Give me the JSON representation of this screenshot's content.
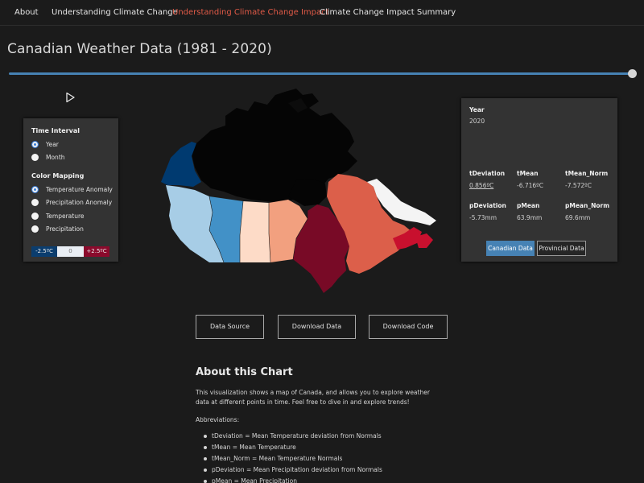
{
  "nav": {
    "items": [
      {
        "label": "About"
      },
      {
        "label": "Understanding Climate Change"
      },
      {
        "label": "Understanding Climate Change Impact"
      },
      {
        "label": "Climate Change Impact Summary"
      }
    ],
    "active_index": 2,
    "active_color": "#e05a47"
  },
  "page": {
    "title": "Canadian Weather Data (1981 - 2020)"
  },
  "timeline": {
    "progress": 1.0,
    "accent": "#4682b4",
    "play_icon": "play-icon"
  },
  "controls": {
    "time_interval": {
      "heading": "Time Interval",
      "options": [
        {
          "label": "Year",
          "checked": true
        },
        {
          "label": "Month",
          "checked": false
        }
      ]
    },
    "color_mapping": {
      "heading": "Color Mapping",
      "options": [
        {
          "label": "Temperature Anomaly",
          "checked": true
        },
        {
          "label": "Precipitation Anomaly",
          "checked": false
        },
        {
          "label": "Temperature",
          "checked": false
        },
        {
          "label": "Precipitation",
          "checked": false
        }
      ]
    },
    "legend": {
      "min": "-2.5ºC",
      "mid": "0",
      "max": "+2.5ºC",
      "colors": {
        "min": "#0b3d6e",
        "mid": "#f4f4f4",
        "max": "#8b0a2c"
      }
    }
  },
  "stats": {
    "year_label": "Year",
    "year_value": "2020",
    "metrics": [
      {
        "label": "tDeviation",
        "value": "0.856ºC"
      },
      {
        "label": "tMean",
        "value": "-6.716ºC"
      },
      {
        "label": "tMean_Norm",
        "value": "-7.572ºC"
      },
      {
        "label": "pDeviation",
        "value": "-5.73mm"
      },
      {
        "label": "pMean",
        "value": "63.9mm"
      },
      {
        "label": "pMean_Norm",
        "value": "69.6mm"
      }
    ],
    "buttons": {
      "canadian": "Canadian Data",
      "provincial": "Provincial Data"
    }
  },
  "map": {
    "region_colors": {
      "yukon": "#003a70",
      "northern_territories": "#050505",
      "british_columbia": "#a7cde6",
      "alberta": "#4291c7",
      "saskatchewan": "#fddbc7",
      "manitoba": "#f2a07f",
      "ontario": "#780a26",
      "quebec": "#dc5f4a",
      "labrador": "#f4f4f4",
      "maritimes": "#c8102e"
    }
  },
  "actions": {
    "data_source": "Data Source",
    "download_data": "Download Data",
    "download_code": "Download Code"
  },
  "about": {
    "title": "About this Chart",
    "description": "This visualization shows a map of Canada, and allows you to explore weather data at different points in time. Feel free to dive in and explore trends!",
    "abbreviations_heading": "Abbreviations:",
    "abbreviations": [
      "tDeviation = Mean Temperature deviation from Normals",
      "tMean = Mean Temperature",
      "tMean_Norm = Mean Temperature Normals",
      "pDeviation = Mean Precipitation deviation from Normals",
      "pMean = Mean Precipitation"
    ]
  }
}
